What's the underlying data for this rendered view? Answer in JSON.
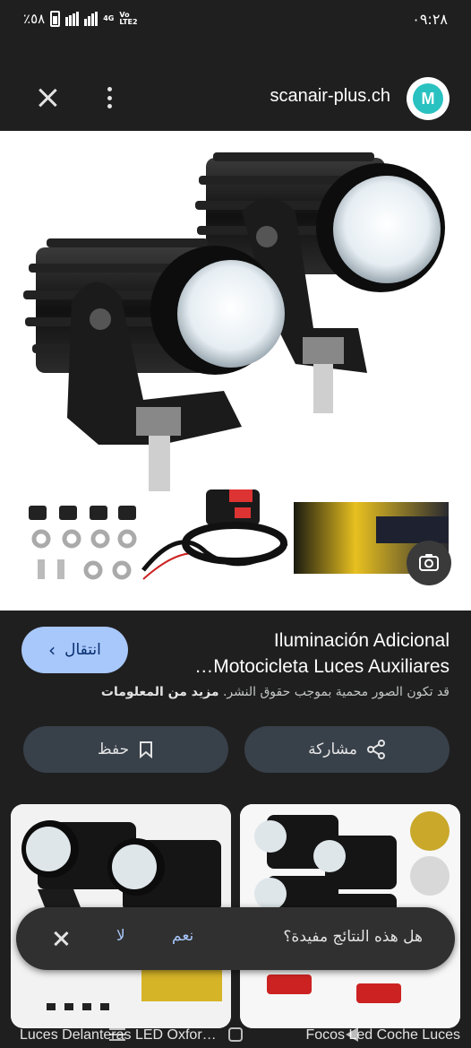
{
  "status_bar": {
    "battery_text": "٥٨٪",
    "network_1": "4G",
    "network_2": "Vo LTE2",
    "time": "٠٩:٢٨"
  },
  "header": {
    "site_name": "scanair-plus.ch",
    "logo_letter": "M"
  },
  "result": {
    "title_line1": "Iluminación Adicional",
    "title_line2": "Motocicleta Luces Auxiliares…",
    "visit_label": "انتقال",
    "copyright_text": "قد تكون الصور محمية بموجب حقوق النشر.",
    "more_info": "مزيد من المعلومات",
    "save_label": "حفظ",
    "share_label": "مشاركة"
  },
  "related": [
    {
      "label": "Luces Delanteras LED Oxfor…"
    },
    {
      "label": "Focos Led Coche Luces"
    }
  ],
  "feedback": {
    "question": "هل هذه النتائج مفيدة؟",
    "yes": "نعم",
    "no": "لا"
  },
  "colors": {
    "background": "#1f1f1f",
    "visit_button": "#a8c7fa",
    "action_button": "#38404a",
    "logo_teal": "#29c2c0"
  }
}
